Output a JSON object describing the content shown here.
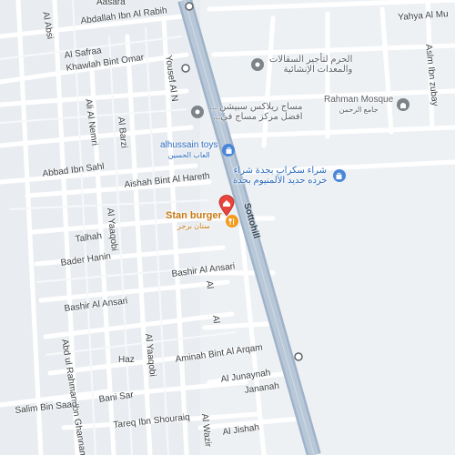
{
  "streets": {
    "aasara": "Aasara",
    "al_absi": "Al Absi",
    "abdallah_ibn_al_rabih": "Abdallah Ibn Al Rabih",
    "yahya_al_mu": "Yahya Al Mu",
    "al_safraa": "Al Safraa",
    "khawlah_bint_omar": "Khawlah Bint Omar",
    "yousef_al_n": "Yousef Al N",
    "aslm_ibn_zubayr": "Aslm Ibn zubay",
    "ali_al_nemri": "Ali Al Nemri",
    "al_barzi": "Al Barzi",
    "abbad_ibn_sahl": "Abbad Ibn Sahl",
    "aishah_bint_al_hareth": "Aishah Bint Al Hareth",
    "al_yaaqobi_1": "Al Yaaqobi",
    "talhah": "Talhah",
    "bader_hanin": "Bader Hanin",
    "bashir_al_ansari_1": "Bashir Al Ansari",
    "bashir_al_ansari_2": "Bashir Al Ansari",
    "al_short_1": "Al",
    "al_short_2": "Al",
    "al_yaaqobi_2": "Al Yaaqobi",
    "haz": "Haz",
    "abd_ul_rahman": "Abd ul Rahman Ibn Ghannam",
    "aminah_bint_al_arqam": "Aminah Bint Al Arqam",
    "al_junaynah": "Al Junaynah",
    "jananah": "Jananah",
    "salim_bin_saad": "Salim Bin Saad",
    "bani_sar": "Bani Sar",
    "tareq_ibn_shouraiq": "Tareq Ibn Shouraiq",
    "al_wazir": "Al Wazir",
    "al_jishah": "Al Jishah",
    "sottohill": "Sottohill"
  },
  "pois": {
    "haram": {
      "line1": "الحرم لتأجير السقالات",
      "line2": "والمعدات الإنشائية",
      "icon": "pin-icon",
      "color": "#7d8489"
    },
    "rahman_mosque": {
      "line1": "Rahman Mosque",
      "line2": "جامع الرحمن",
      "icon": "mosque-icon",
      "color": "#7d8489"
    },
    "massage": {
      "line1": "مساج ريلاكس سبيشن ...",
      "line2": "افضل مركز مساج في...",
      "icon": "pin-icon",
      "color": "#7d8489"
    },
    "alhussain_toys": {
      "line1": "alhussain toys",
      "line2": "العاب الحسين",
      "icon": "shopping-bag-icon",
      "color": "#4a86d8"
    },
    "scrap_buy": {
      "line1": "شراء سكراب بجدة شراء",
      "line2": "خرده حديد الألمنيوم بجدة",
      "icon": "shopping-bag-icon",
      "color": "#4a86d8"
    },
    "red_pin": {
      "icon": "home-pin-icon",
      "color": "#e8453c"
    },
    "stan_burger": {
      "line1": "Stan burger",
      "line2": "ستان برجر",
      "icon": "fork-knife-icon",
      "color": "#f29b1d"
    }
  }
}
